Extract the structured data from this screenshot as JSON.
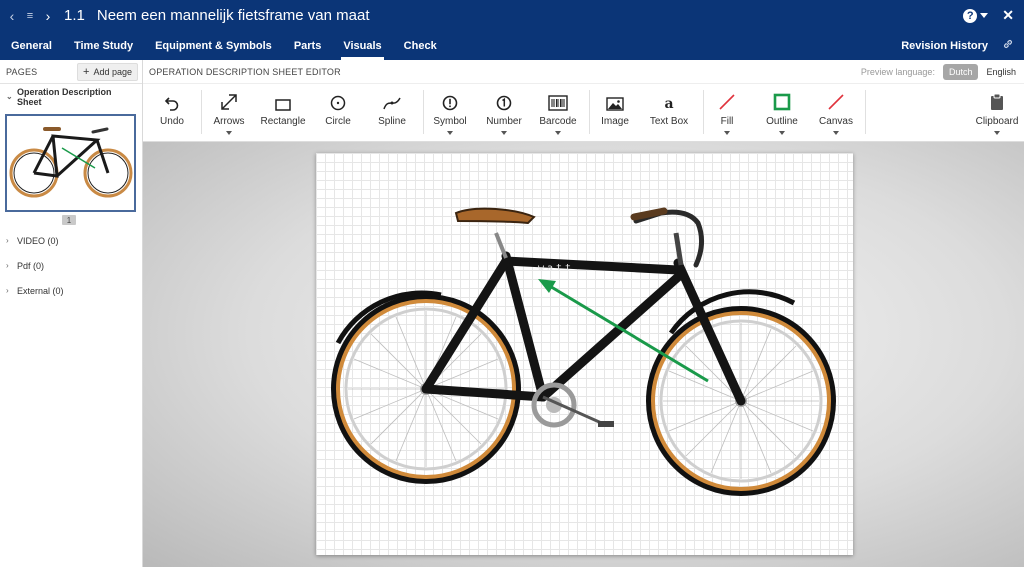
{
  "header": {
    "number": "1.1",
    "title": "Neem een mannelijk fietsframe van maat"
  },
  "tabs": [
    "General",
    "Time Study",
    "Equipment & Symbols",
    "Parts",
    "Visuals",
    "Check"
  ],
  "active_tab": "Visuals",
  "revision_history": "Revision History",
  "sidebar": {
    "pages_label": "PAGES",
    "add_page": "Add page",
    "operation_sheet": "Operation Description Sheet",
    "thumb_page_number": "1",
    "sections": [
      "VIDEO (0)",
      "Pdf (0)",
      "External (0)"
    ]
  },
  "editor": {
    "title": "OPERATION DESCRIPTION SHEET EDITOR",
    "preview_language_label": "Preview language:",
    "languages": [
      "Dutch",
      "English"
    ],
    "selected_language": "Dutch"
  },
  "toolbar": {
    "undo": "Undo",
    "arrows": "Arrows",
    "rectangle": "Rectangle",
    "circle": "Circle",
    "spline": "Spline",
    "symbol": "Symbol",
    "number": "Number",
    "barcode": "Barcode",
    "image": "Image",
    "text_box": "Text Box",
    "fill": "Fill",
    "outline": "Outline",
    "canvas": "Canvas",
    "clipboard": "Clipboard"
  },
  "canvas": {
    "frame_brand": "watt",
    "arrow_color": "#1a9a4a",
    "outline_color": "#1a9a4a",
    "no_fill_color": "#e0323c"
  },
  "colors": {
    "navy": "#0b3577"
  }
}
